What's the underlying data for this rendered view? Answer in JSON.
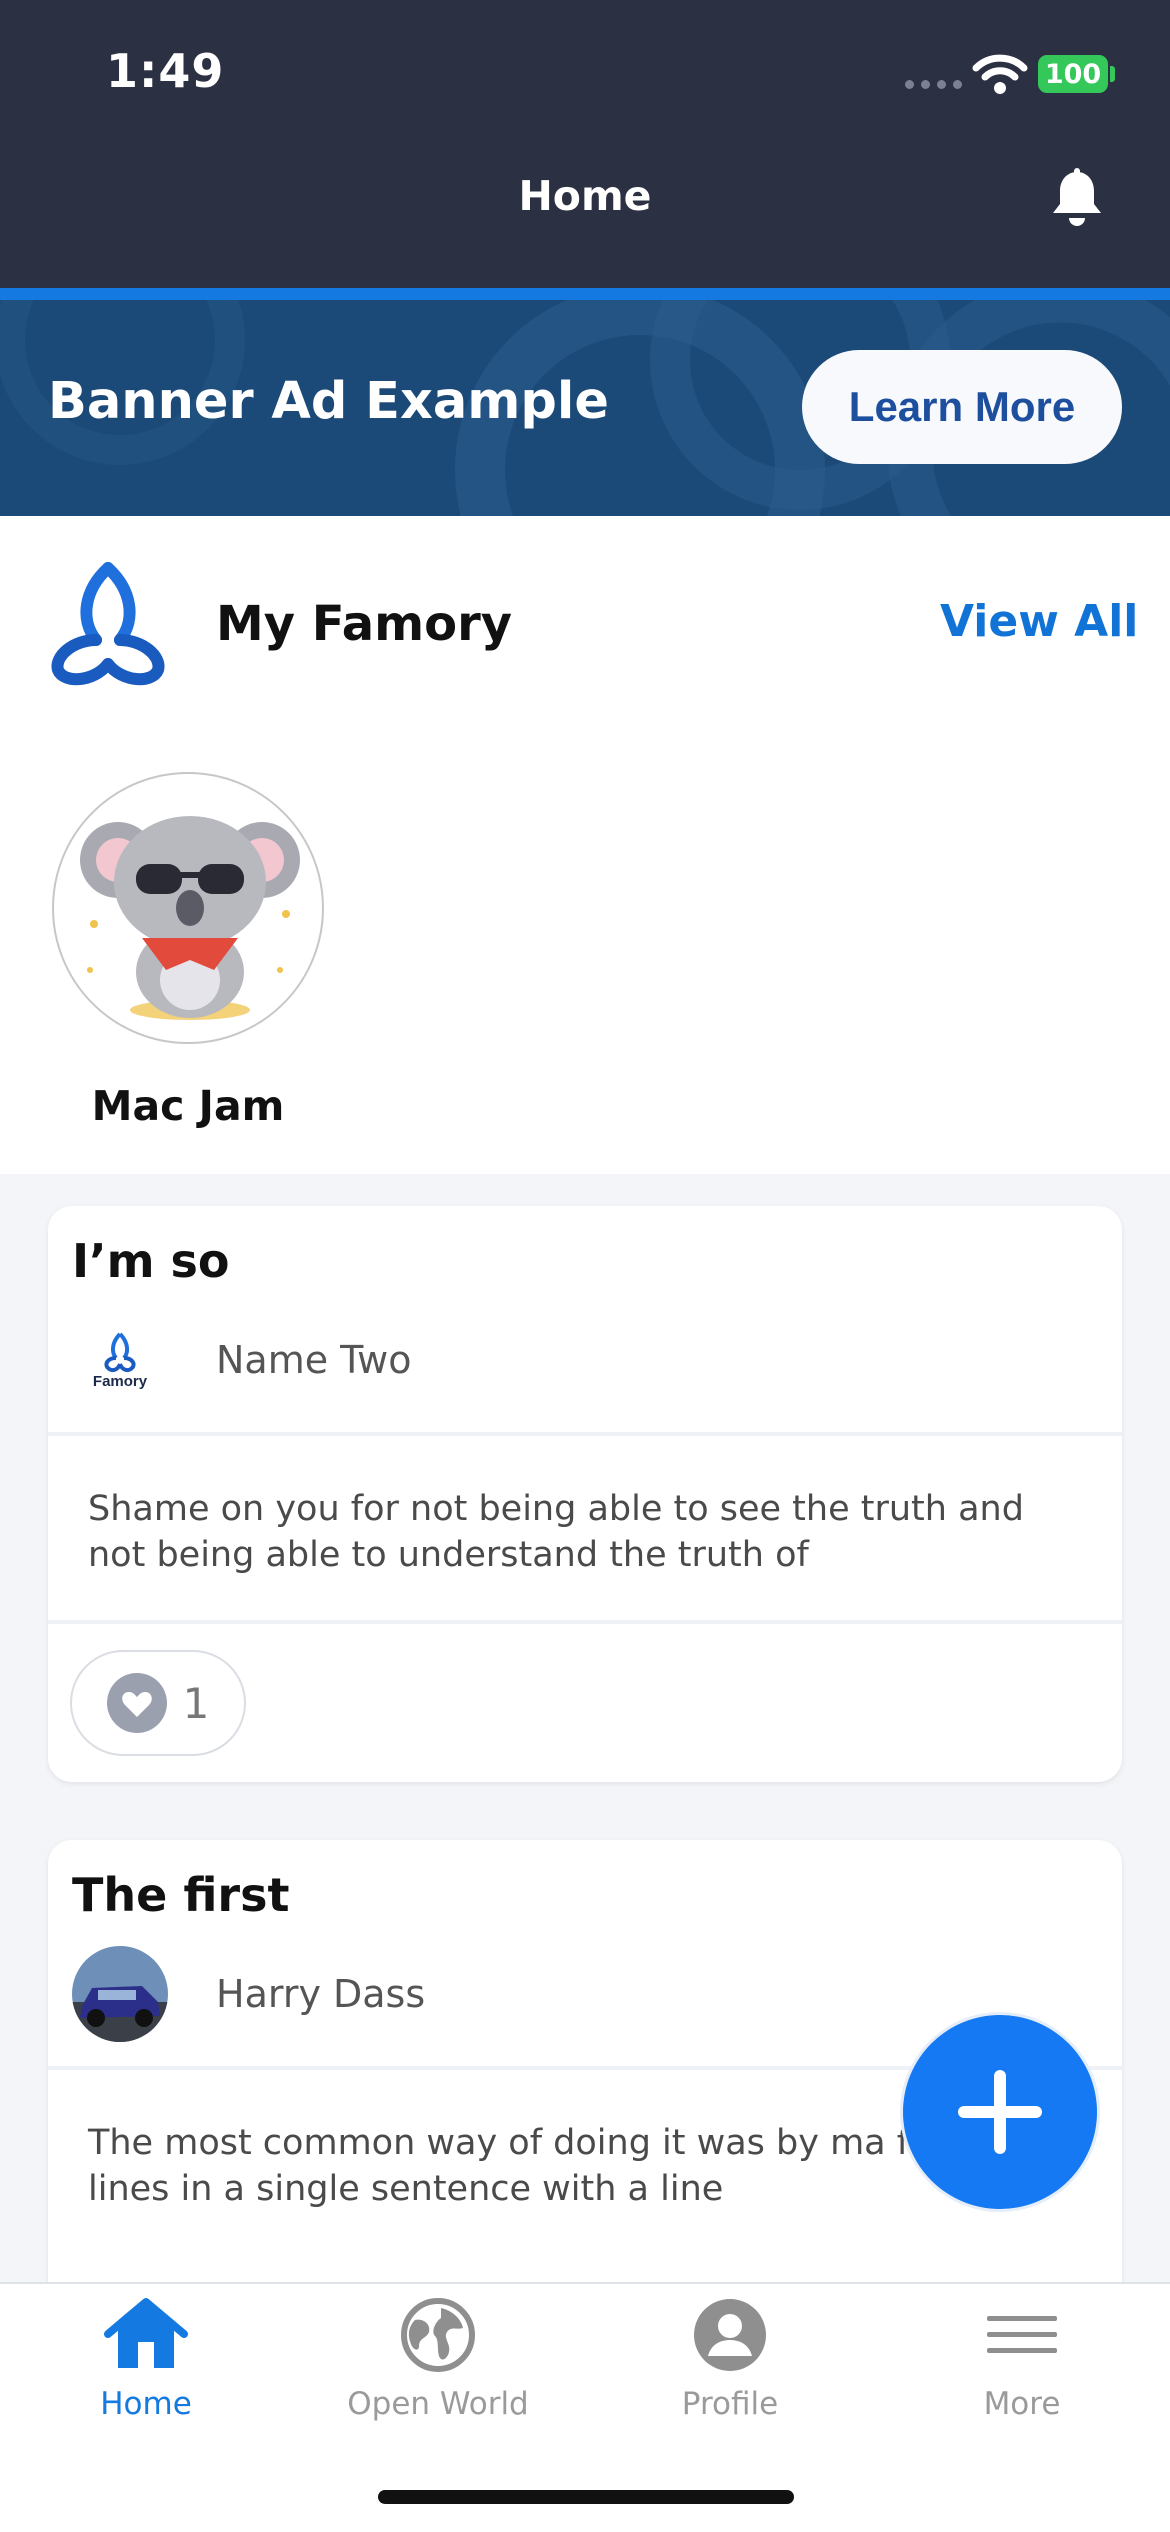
{
  "status_bar": {
    "time": "1:49",
    "battery": "100"
  },
  "header": {
    "title": "Home",
    "notification_icon": "bell-icon"
  },
  "banner": {
    "title": "Banner Ad Example",
    "button_label": "Learn More"
  },
  "famory": {
    "title": "My Famory",
    "view_all_label": "View All",
    "members": [
      {
        "name": "Mac Jam"
      }
    ]
  },
  "posts": [
    {
      "title": "I’m so",
      "author": "Name Two",
      "author_logo_text": "Famory",
      "body": "Shame on you for not being able to see the truth and not being able to understand the truth of",
      "likes": "1"
    },
    {
      "title": "The first",
      "author": "Harry Dass",
      "body": "The most common way of doing it was by ma first two lines in a single sentence with a line"
    }
  ],
  "nav": {
    "items": [
      {
        "label": "Home",
        "icon": "home-icon",
        "active": true
      },
      {
        "label": "Open World",
        "icon": "globe-icon",
        "active": false
      },
      {
        "label": "Profile",
        "icon": "profile-icon",
        "active": false
      },
      {
        "label": "More",
        "icon": "menu-icon",
        "active": false
      }
    ]
  },
  "colors": {
    "accent": "#1479e0",
    "header_bg": "#2b3042",
    "banner_bg": "#1d4d7b",
    "fab": "#1479f2"
  }
}
